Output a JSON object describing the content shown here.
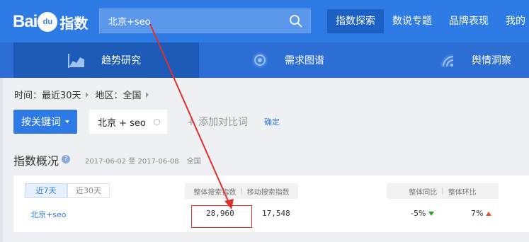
{
  "header": {
    "logo": {
      "bai": "Bai",
      "du": "du",
      "zhishu": "指数"
    },
    "search": {
      "value": "北京+seo"
    },
    "nav": [
      {
        "label": "指数探索"
      },
      {
        "label": "数说专题"
      },
      {
        "label": "品牌表现"
      },
      {
        "label": "我的"
      }
    ]
  },
  "subnav": [
    {
      "label": "趋势研究"
    },
    {
      "label": "需求图谱"
    },
    {
      "label": "舆情洞察"
    }
  ],
  "filters": {
    "time_label": "时间：最近30天",
    "region_label": "地区：全国"
  },
  "keyword_bar": {
    "button_label": "按关键词",
    "keyword": "北京 + seo",
    "add_compare": "+ 添加对比词",
    "confirm": "确定"
  },
  "overview": {
    "title": "指数概况",
    "help": "?",
    "date_range": "2017-06-02 至 2017-06-08",
    "region": "全国",
    "tabs": [
      "近7天",
      "近30天"
    ],
    "columns": {
      "overall_search": "整体搜索指数",
      "mobile_search": "移动搜索指数",
      "yoy": "整体同比",
      "mom": "整体环比"
    },
    "row": {
      "keyword": "北京+seo",
      "overall": "28,960",
      "mobile": "17,548",
      "yoy": "-5%",
      "mom": "7%"
    }
  },
  "colors": {
    "header_blue": "#2f7be6",
    "subnav_blue": "#2c6ed4",
    "annotation_red": "#e0302b",
    "up_red": "#e8503a",
    "down_green": "#1fb01f"
  }
}
